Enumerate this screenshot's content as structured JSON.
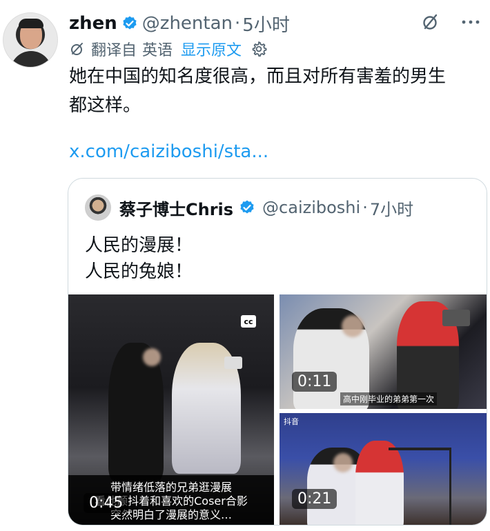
{
  "tweet": {
    "author_name": "zhen",
    "handle": "@zhentan",
    "separator": "·",
    "time": "5小时",
    "translate_prefix": "翻译自",
    "translate_language": "英语",
    "show_original": "显示原文",
    "body_line1": "她在中国的知名度很高，而且对所有害羞的男生",
    "body_line2": "都这样。",
    "link": "x.com/caiziboshi/sta..."
  },
  "icons": {
    "verified": "verified-badge-icon",
    "grok": "grok-icon",
    "more": "more-icon",
    "translate": "translate-icon",
    "settings": "gear-icon"
  },
  "quote": {
    "author_name": "蔡子博士Chris",
    "handle": "@caiziboshi",
    "separator": "·",
    "time": "7小时",
    "body_line1": "人民的漫展！",
    "body_line2": "人民的兔娘！",
    "media": {
      "main": {
        "cc_label": "cc",
        "subtitle_line1": "带情绪低落的兄弟逛漫展",
        "subtitle_line2": "看他颤抖着和喜欢的Coser合影",
        "subtitle_line3": "突然明白了漫展的意义…",
        "duration": "0:45"
      },
      "top_right": {
        "caption": "高中刚毕业的弟弟第一次",
        "duration": "0:11"
      },
      "bottom_right": {
        "platform_label": "抖音",
        "duration": "0:21"
      }
    }
  },
  "colors": {
    "accent": "#1d9bf0",
    "text": "#0f1419",
    "secondary": "#536471",
    "border": "#cfd9de"
  }
}
